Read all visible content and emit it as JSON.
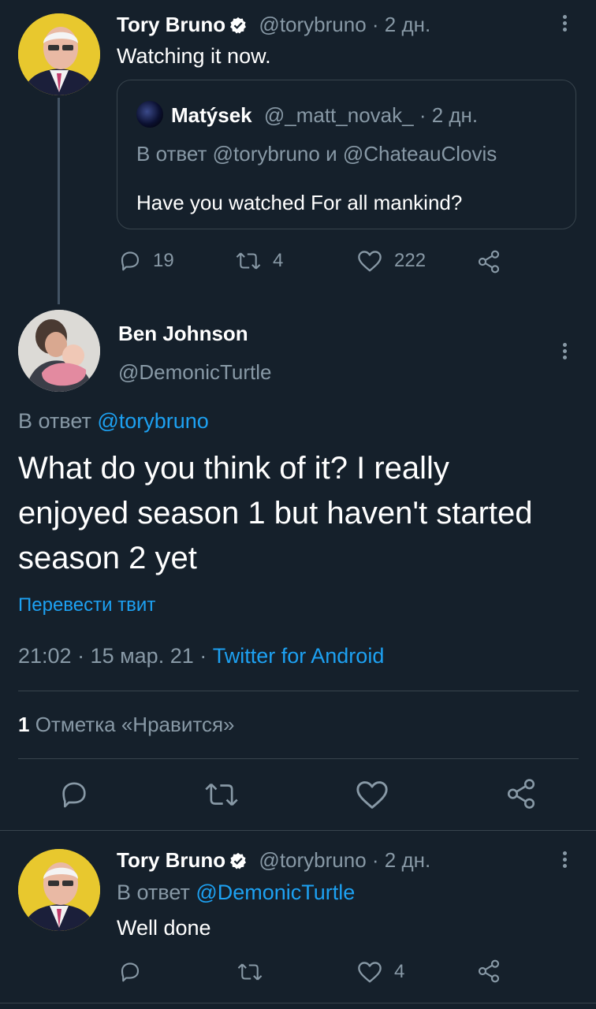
{
  "tweet1": {
    "author_name": "Tory Bruno",
    "author_handle": "@torybruno",
    "time": "· 2 дн.",
    "text": "Watching it now.",
    "quote": {
      "author_name": "Matýsek",
      "author_handle": "@_matt_novak_",
      "time": "· 2 дн.",
      "reply_to": "В ответ @torybruno и @ChateauClovis",
      "text": "Have you watched For all mankind?"
    },
    "replies": "19",
    "retweets": "4",
    "likes": "222"
  },
  "main_tweet": {
    "author_name": "Ben Johnson",
    "author_handle": "@DemonicTurtle",
    "reply_prefix": "В ответ",
    "reply_handle": "@torybruno",
    "text": "What do you think of it? I really enjoyed season 1 but haven't started season 2 yet",
    "translate": "Перевести твит",
    "timestamp": "21:02 · 15 мар. 21 ·",
    "client": "Twitter for Android",
    "likes_count": "1",
    "likes_label": "Отметка «Нравится»"
  },
  "tweet3": {
    "author_name": "Tory Bruno",
    "author_handle": "@torybruno",
    "time": "· 2 дн.",
    "reply_prefix": "В ответ",
    "reply_handle": "@DemonicTurtle",
    "text": "Well done",
    "replies": "",
    "retweets": "",
    "likes": "4"
  },
  "colors": {
    "background": "#15202b",
    "muted": "#8899a6",
    "accent": "#1da1f2",
    "divider": "#38444d"
  }
}
